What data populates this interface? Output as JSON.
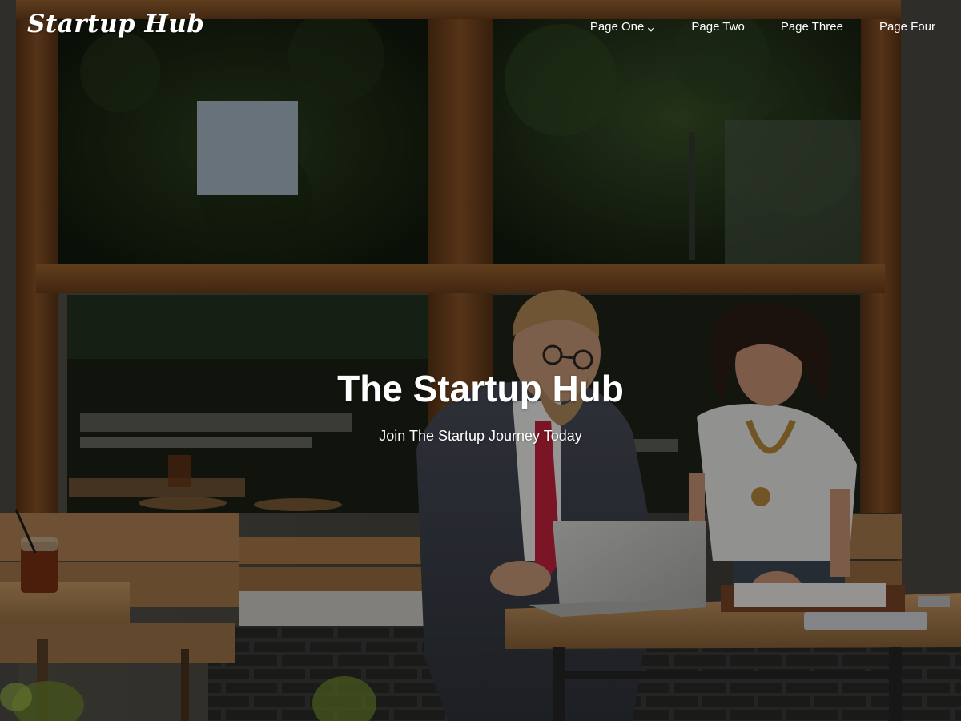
{
  "header": {
    "logo_text": "Startup Hub",
    "nav": [
      {
        "label": "Page One",
        "has_dropdown": true
      },
      {
        "label": "Page Two",
        "has_dropdown": false
      },
      {
        "label": "Page Three",
        "has_dropdown": false
      },
      {
        "label": "Page Four",
        "has_dropdown": false
      }
    ]
  },
  "hero": {
    "title": "The Startup Hub",
    "subtitle": "Join The Startup Journey Today",
    "overlay_color": "#000000",
    "colors": {
      "wood_frame": "#7a4a22",
      "foliage": "#1f2b16",
      "tabletop": "#b98a55",
      "brick": "#2b2b2b"
    }
  },
  "icons": {
    "dropdown": "chevron-down-icon"
  }
}
